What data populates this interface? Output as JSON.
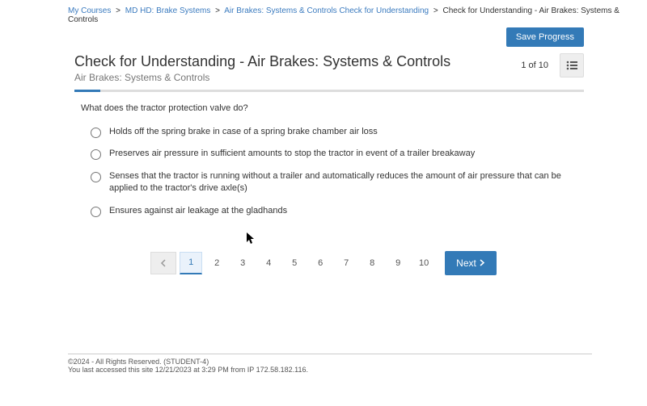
{
  "breadcrumb": {
    "items": [
      {
        "label": "My Courses"
      },
      {
        "label": "MD HD: Brake Systems"
      },
      {
        "label": "Air Brakes: Systems & Controls Check for Understanding"
      }
    ],
    "current": "Check for Understanding - Air Brakes: Systems & Controls"
  },
  "save_button": "Save Progress",
  "title": "Check for Understanding - Air Brakes: Systems & Controls",
  "subtitle": "Air Brakes: Systems & Controls",
  "counter": "1 of 10",
  "question": "What does the tractor protection valve do?",
  "options": [
    {
      "text": "Holds off the spring brake in case of a spring brake chamber air loss"
    },
    {
      "text": "Preserves air pressure in sufficient amounts to stop the tractor in event of a trailer breakaway"
    },
    {
      "text": "Senses that the tractor is running without a trailer and automatically reduces the amount of air pressure that can be applied to the tractor's drive axle(s)"
    },
    {
      "text": "Ensures against air leakage at the gladhands"
    }
  ],
  "pager": {
    "pages": [
      "1",
      "2",
      "3",
      "4",
      "5",
      "6",
      "7",
      "8",
      "9",
      "10"
    ],
    "next_label": "Next"
  },
  "footer": {
    "line1": "©2024 - All Rights Reserved. (STUDENT-4)",
    "line2": "You last accessed this site 12/21/2023 at 3:29 PM from IP 172.58.182.116."
  }
}
